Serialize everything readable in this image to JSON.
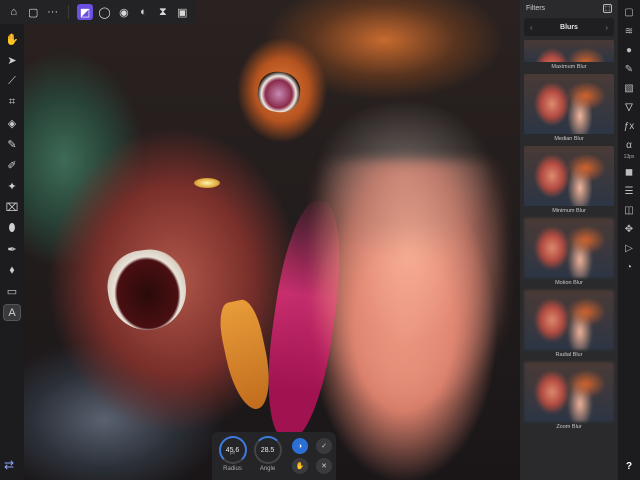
{
  "topbar": {
    "icons": [
      "menu-icon",
      "document-icon",
      "more-icon",
      "photo-persona-icon",
      "selection-persona-icon",
      "liquify-persona-icon",
      "develop-persona-icon",
      "tone-map-persona-icon",
      "export-persona-icon"
    ],
    "glyphs": [
      "⌂",
      "▢",
      "···",
      "◩",
      "◯",
      "◉",
      "◐",
      "⧗",
      "▣"
    ]
  },
  "tools": {
    "glyphs": [
      "✋",
      "➤",
      "⟋",
      "⌗",
      "◈",
      "✎",
      "✐",
      "✦",
      "⌧",
      "⬮",
      "✒",
      "⬧",
      "▭",
      "A"
    ]
  },
  "bottom_tool": "⇄",
  "dials": [
    {
      "label": "Radius",
      "value": "45.6",
      "unit": "px"
    },
    {
      "label": "Angle",
      "value": "28.5",
      "unit": "º"
    }
  ],
  "dial_buttons": [
    "◑",
    "✓",
    "✋",
    "✕"
  ],
  "filters": {
    "title": "Filters",
    "options_glyph": "⬚",
    "category_left": "‹",
    "category": "Blurs",
    "category_right": "›",
    "items": [
      "Maximum Blur",
      "Median Blur",
      "Minimum Blur",
      "Motion Blur",
      "Radial Blur",
      "Zoom Blur"
    ]
  },
  "studio": {
    "glyphs": [
      "▢",
      "≋",
      "●",
      "✎",
      "▧",
      "▽",
      "ƒx",
      "α",
      "◼",
      "☰",
      "◫",
      "✥",
      "▷",
      "◔"
    ],
    "alpha_caption": "13px",
    "help": "?"
  }
}
